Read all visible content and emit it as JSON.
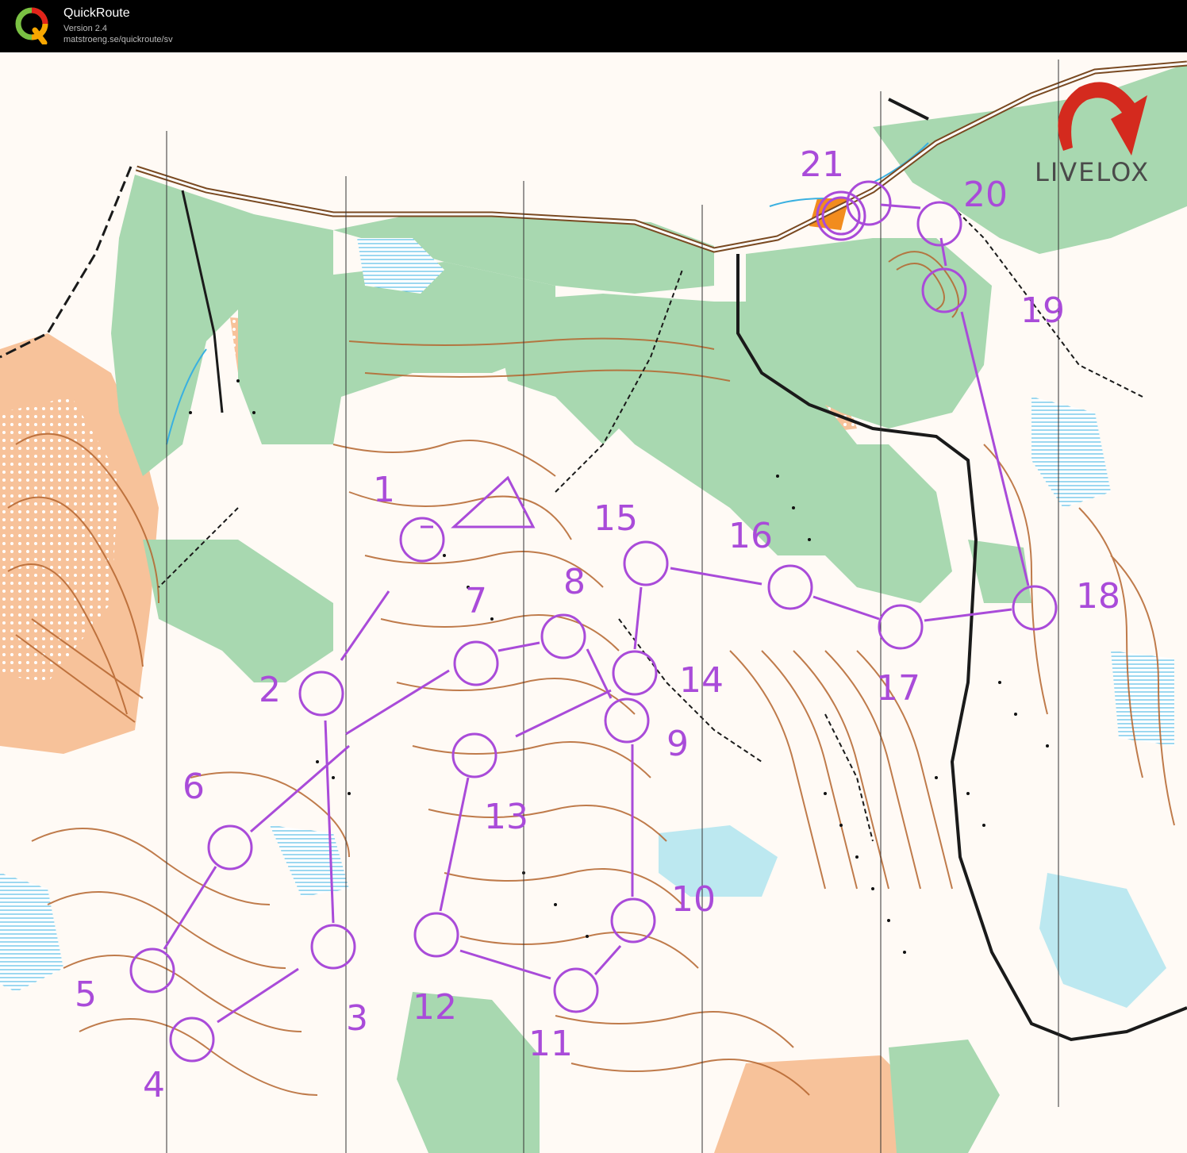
{
  "header": {
    "app_title": "QuickRoute",
    "version": "Version 2.4",
    "url": "matstroeng.se/quickroute/sv"
  },
  "map": {
    "brand": "LIVELOX",
    "colors": {
      "course": "#a94bd9",
      "vegetation": "#a8d8b0",
      "open_land": "#f7c29a",
      "contour": "#b5652e",
      "water": "#8fd5ee",
      "road": "#1a1a1a"
    },
    "controls": [
      {
        "number": "1"
      },
      {
        "number": "2"
      },
      {
        "number": "3"
      },
      {
        "number": "4"
      },
      {
        "number": "5"
      },
      {
        "number": "6"
      },
      {
        "number": "7"
      },
      {
        "number": "8"
      },
      {
        "number": "9"
      },
      {
        "number": "10"
      },
      {
        "number": "11"
      },
      {
        "number": "12"
      },
      {
        "number": "13"
      },
      {
        "number": "14"
      },
      {
        "number": "15"
      },
      {
        "number": "16"
      },
      {
        "number": "17"
      },
      {
        "number": "18"
      },
      {
        "number": "19"
      },
      {
        "number": "20"
      },
      {
        "number": "21"
      }
    ]
  }
}
